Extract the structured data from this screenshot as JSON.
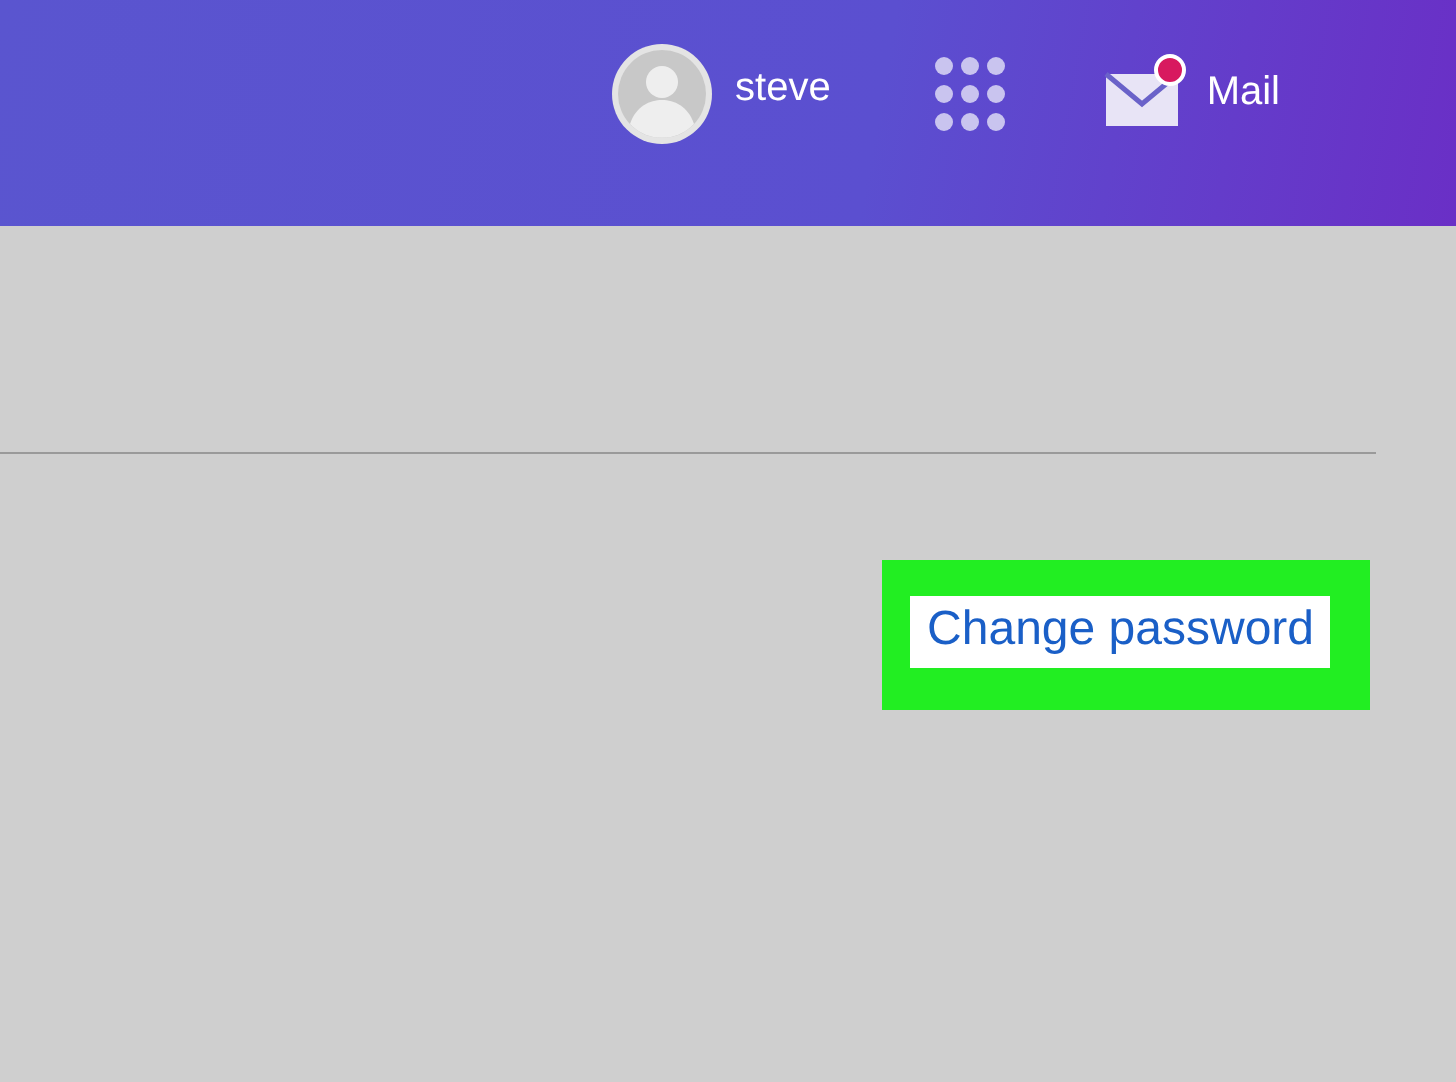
{
  "header": {
    "user": {
      "name": "steve"
    },
    "mail": {
      "label": "Mail",
      "unread": true
    }
  },
  "security": {
    "link": "Change password",
    "highlighted": true
  }
}
